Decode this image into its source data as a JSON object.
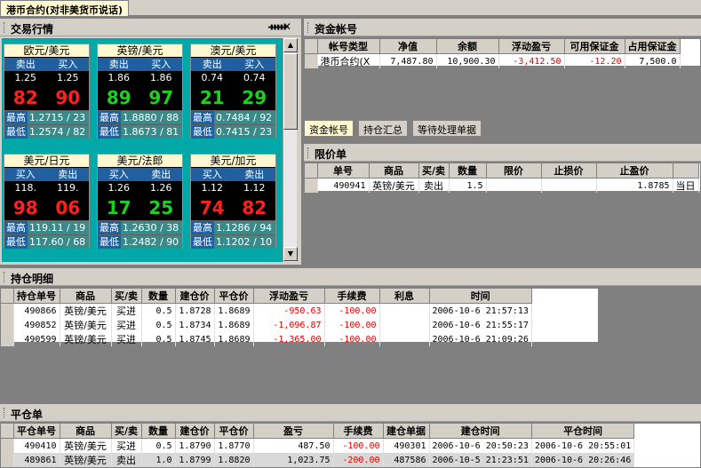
{
  "tab": {
    "title": "港币合约(对非美货币说话)"
  },
  "quotes": {
    "title": "交易行情",
    "pin": "ᚔ",
    "close": "✕",
    "cards": [
      {
        "name": "欧元/美元",
        "sell": "卖出",
        "buy": "买入",
        "sell_sm": "1.25",
        "buy_sm": "1.25",
        "sell_big": "82",
        "buy_big": "90",
        "color": "red",
        "high_lbl": "最高",
        "high": "1.2715 / 23",
        "low_lbl": "最低",
        "low": "1.2574 / 82"
      },
      {
        "name": "英镑/美元",
        "sell": "卖出",
        "buy": "买入",
        "sell_sm": "1.86",
        "buy_sm": "1.86",
        "sell_big": "89",
        "buy_big": "97",
        "color": "green",
        "high_lbl": "最高",
        "high": "1.8880 / 88",
        "low_lbl": "最低",
        "low": "1.8673 / 81"
      },
      {
        "name": "澳元/美元",
        "sell": "卖出",
        "buy": "买入",
        "sell_sm": "0.74",
        "buy_sm": "0.74",
        "sell_big": "21",
        "buy_big": "29",
        "color": "green",
        "high_lbl": "最高",
        "high": "0.7484 / 92",
        "low_lbl": "最低",
        "low": "0.7415 / 23"
      },
      {
        "name": "美元/日元",
        "sell": "买入",
        "buy": "卖出",
        "sell_sm": "118.",
        "buy_sm": "119.",
        "sell_big": "98",
        "buy_big": "06",
        "color": "red",
        "high_lbl": "最高",
        "high": "119.11 / 19",
        "low_lbl": "最低",
        "low": "117.60 / 68"
      },
      {
        "name": "美元/法郎",
        "sell": "买入",
        "buy": "卖出",
        "sell_sm": "1.26",
        "buy_sm": "1.26",
        "sell_big": "17",
        "buy_big": "25",
        "color": "green",
        "high_lbl": "最高",
        "high": "1.2630 / 38",
        "low_lbl": "最低",
        "low": "1.2482 / 90"
      },
      {
        "name": "美元/加元",
        "sell": "买入",
        "buy": "卖出",
        "sell_sm": "1.12",
        "buy_sm": "1.12",
        "sell_big": "74",
        "buy_big": "82",
        "color": "red",
        "high_lbl": "最高",
        "high": "1.1286 / 94",
        "low_lbl": "最低",
        "low": "1.1202 / 10"
      }
    ]
  },
  "account": {
    "title": "资金帐号",
    "columns": [
      "帐号类型",
      "净值",
      "余额",
      "浮动盈亏",
      "可用保证金",
      "占用保证金"
    ],
    "rows": [
      [
        "港币合约(X",
        "7,487.80",
        "10,900.30",
        "-3,412.50",
        "-12.20",
        "7,500.0"
      ]
    ]
  },
  "subtabs": [
    "资金帐号",
    "持仓汇总",
    "等待处理单据"
  ],
  "limit": {
    "title": "限价单",
    "columns": [
      "单号",
      "商品",
      "买/卖",
      "数量",
      "限价",
      "止损价",
      "止盈价",
      ""
    ],
    "rows": [
      [
        "490941",
        "英镑/美元",
        "卖出",
        "1.5",
        "",
        "",
        "1.8785",
        "当日"
      ]
    ]
  },
  "positions": {
    "title": "持仓明细",
    "columns": [
      "持仓单号",
      "商品",
      "买/卖",
      "数量",
      "建仓价",
      "平仓价",
      "浮动盈亏",
      "手续费",
      "利息",
      "时间"
    ],
    "rows": [
      [
        "490866",
        "英镑/美元",
        "买进",
        "0.5",
        "1.8728",
        "1.8689",
        "-950.63",
        "-100.00",
        "",
        "2006-10-6 21:57:13"
      ],
      [
        "490852",
        "英镑/美元",
        "买进",
        "0.5",
        "1.8734",
        "1.8689",
        "-1,096.87",
        "-100.00",
        "",
        "2006-10-6 21:55:17"
      ],
      [
        "490599",
        "英镑/美元",
        "买进",
        "0.5",
        "1.8745",
        "1.8689",
        "-1,365.00",
        "-100.00",
        "",
        "2006-10-6 21:09:26"
      ]
    ]
  },
  "closed": {
    "title": "平仓单",
    "columns": [
      "平仓单号",
      "商品",
      "买/卖",
      "数量",
      "建仓价",
      "平仓价",
      "盈亏",
      "手续费",
      "建仓单据",
      "建仓时间",
      "平仓时间"
    ],
    "rows": [
      [
        "490410",
        "英镑/美元",
        "买进",
        "0.5",
        "1.8790",
        "1.8770",
        "487.50",
        "-100.00",
        "490301",
        "2006-10-6 20:50:23",
        "2006-10-6 20:55:01"
      ],
      [
        "489861",
        "英镑/美元",
        "卖出",
        "1.0",
        "1.8799",
        "1.8820",
        "1,023.75",
        "-200.00",
        "487586",
        "2006-10-5 21:23:51",
        "2006-10-6 20:26:46"
      ]
    ]
  }
}
